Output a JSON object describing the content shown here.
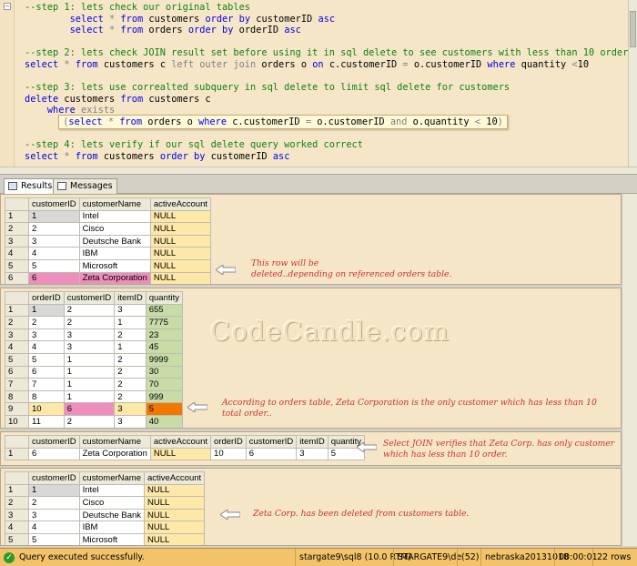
{
  "editor": {
    "lines": [
      [
        {
          "t": "--step 1: lets check our original tables",
          "c": "cm"
        }
      ],
      [
        {
          "t": "        "
        },
        {
          "t": "select",
          "c": "kw"
        },
        {
          "t": " "
        },
        {
          "t": "*",
          "c": "gr"
        },
        {
          "t": " "
        },
        {
          "t": "from",
          "c": "kw"
        },
        {
          "t": " customers "
        },
        {
          "t": "order by",
          "c": "kw"
        },
        {
          "t": " customerID "
        },
        {
          "t": "asc",
          "c": "kw"
        }
      ],
      [
        {
          "t": "        "
        },
        {
          "t": "select",
          "c": "kw"
        },
        {
          "t": " "
        },
        {
          "t": "*",
          "c": "gr"
        },
        {
          "t": " "
        },
        {
          "t": "from",
          "c": "kw"
        },
        {
          "t": " orders "
        },
        {
          "t": "order by",
          "c": "kw"
        },
        {
          "t": " orderID "
        },
        {
          "t": "asc",
          "c": "kw"
        }
      ],
      [
        {
          "t": ""
        }
      ],
      [
        {
          "t": "--step 2: lets check JOIN result set before using it in sql delete to see customers with less than 10 order",
          "c": "cm"
        }
      ],
      [
        {
          "t": "select",
          "c": "kw"
        },
        {
          "t": " "
        },
        {
          "t": "*",
          "c": "gr"
        },
        {
          "t": " "
        },
        {
          "t": "from",
          "c": "kw"
        },
        {
          "t": " customers c "
        },
        {
          "t": "left outer join",
          "c": "gr"
        },
        {
          "t": " orders o "
        },
        {
          "t": "on",
          "c": "kw"
        },
        {
          "t": " c.customerID "
        },
        {
          "t": "=",
          "c": "gr"
        },
        {
          "t": " o.customerID "
        },
        {
          "t": "where",
          "c": "kw"
        },
        {
          "t": " quantity "
        },
        {
          "t": "<",
          "c": "gr"
        },
        {
          "t": "10"
        }
      ],
      [
        {
          "t": ""
        }
      ],
      [
        {
          "t": "--step 3: lets use correalted subquery in sql delete to limit sql delete for customers",
          "c": "cm"
        }
      ],
      [
        {
          "t": "delete",
          "c": "kw"
        },
        {
          "t": " customers "
        },
        {
          "t": "from",
          "c": "kw"
        },
        {
          "t": " customers c"
        }
      ],
      [
        {
          "t": "    "
        },
        {
          "t": "where",
          "c": "kw"
        },
        {
          "t": " "
        },
        {
          "t": "exists",
          "c": "gr"
        }
      ],
      [
        {
          "t": "      "
        },
        {
          "t": "(",
          "c": "gr"
        },
        {
          "t": "select",
          "c": "kw"
        },
        {
          "t": " "
        },
        {
          "t": "*",
          "c": "gr"
        },
        {
          "t": " "
        },
        {
          "t": "from",
          "c": "kw"
        },
        {
          "t": " orders o "
        },
        {
          "t": "where",
          "c": "kw"
        },
        {
          "t": " c.customerID "
        },
        {
          "t": "=",
          "c": "gr"
        },
        {
          "t": " o.customerID "
        },
        {
          "t": "and",
          "c": "gr"
        },
        {
          "t": " o.quantity "
        },
        {
          "t": "<",
          "c": "gr"
        },
        {
          "t": " 10"
        },
        {
          "t": ")",
          "c": "gr"
        }
      ],
      [
        {
          "t": ""
        }
      ],
      [
        {
          "t": "--step 4: lets verify if our sql delete query worked correct",
          "c": "cm"
        }
      ],
      [
        {
          "t": "select",
          "c": "kw"
        },
        {
          "t": " "
        },
        {
          "t": "*",
          "c": "gr"
        },
        {
          "t": " "
        },
        {
          "t": "from",
          "c": "kw"
        },
        {
          "t": " customers "
        },
        {
          "t": "order by",
          "c": "kw"
        },
        {
          "t": " customerID "
        },
        {
          "t": "asc",
          "c": "kw"
        }
      ]
    ]
  },
  "tabs": {
    "results": "Results",
    "messages": "Messages"
  },
  "grid1": {
    "columns": [
      "customerID",
      "customerName",
      "activeAccount"
    ],
    "rows": [
      [
        "1",
        "Intel",
        "NULL"
      ],
      [
        "2",
        "Cisco",
        "NULL"
      ],
      [
        "3",
        "Deutsche Bank",
        "NULL"
      ],
      [
        "4",
        "IBM",
        "NULL"
      ],
      [
        "5",
        "Microsoft",
        "NULL"
      ],
      [
        "6",
        "Zeta Corporation",
        "NULL"
      ]
    ]
  },
  "grid2": {
    "columns": [
      "orderID",
      "customerID",
      "itemID",
      "quantity"
    ],
    "rows": [
      [
        "1",
        "2",
        "3",
        "655"
      ],
      [
        "2",
        "2",
        "1",
        "7775"
      ],
      [
        "3",
        "3",
        "2",
        "23"
      ],
      [
        "4",
        "3",
        "1",
        "45"
      ],
      [
        "5",
        "1",
        "2",
        "9999"
      ],
      [
        "6",
        "1",
        "2",
        "30"
      ],
      [
        "7",
        "1",
        "2",
        "70"
      ],
      [
        "8",
        "1",
        "2",
        "999"
      ],
      [
        "10",
        "6",
        "3",
        "5"
      ],
      [
        "11",
        "2",
        "3",
        "40"
      ]
    ],
    "row_numbers": [
      "1",
      "2",
      "3",
      "4",
      "5",
      "6",
      "7",
      "8",
      "9",
      "10"
    ]
  },
  "grid3": {
    "columns": [
      "customerID",
      "customerName",
      "activeAccount",
      "orderID",
      "customerID",
      "itemID",
      "quantity"
    ],
    "rows": [
      [
        "6",
        "Zeta Corporation",
        "NULL",
        "10",
        "6",
        "3",
        "5"
      ]
    ]
  },
  "grid4": {
    "columns": [
      "customerID",
      "customerName",
      "activeAccount"
    ],
    "rows": [
      [
        "1",
        "Intel",
        "NULL"
      ],
      [
        "2",
        "Cisco",
        "NULL"
      ],
      [
        "3",
        "Deutsche Bank",
        "NULL"
      ],
      [
        "4",
        "IBM",
        "NULL"
      ],
      [
        "5",
        "Microsoft",
        "NULL"
      ]
    ]
  },
  "notes": {
    "n1_line1": "This row will be",
    "n1_line2": "deleted..depending on referenced orders table.",
    "n2_line1": "According to orders table, Zeta Corporation is the only customer which has less than 10",
    "n2_line2": "total order..",
    "n3_line1": "Select JOIN verifies that Zeta Corp. has only customer",
    "n3_line2": "which has less than 10 order.",
    "n4": "Zeta Corp. has been deleted from customers table."
  },
  "watermark": "CodeCandle.com",
  "status": {
    "message": "Query executed successfully.",
    "server": "stargate9\\sql8 (10.0 RTM)",
    "user": "STARGATE9\\de",
    "spid": "(52)",
    "database": "nebraska20131018",
    "elapsed": "00:00:01",
    "rows": "22 rows"
  },
  "colors": {
    "editor_bg": "#f6e6c8",
    "comment": "#128012",
    "keyword": "#0000e6",
    "null_cell": "#fde8a8",
    "quantity_cell": "#c8dca8",
    "highlight_pink": "#ee8ebc",
    "highlight_orange": "#f07800",
    "note_red": "#d03030",
    "status_bar": "#f3c36a"
  }
}
